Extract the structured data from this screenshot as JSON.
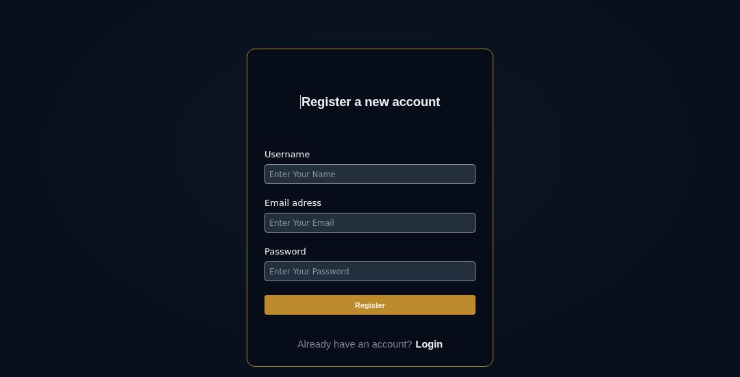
{
  "title": "Register a new account",
  "fields": [
    {
      "label": "Username",
      "placeholder": "Enter Your Name"
    },
    {
      "label": "Email adress",
      "placeholder": "Enter Your Email"
    },
    {
      "label": "Password",
      "placeholder": "Enter Your Password"
    }
  ],
  "submit": "Register",
  "footer": {
    "prompt": "Already have an account?",
    "link": "Login"
  }
}
